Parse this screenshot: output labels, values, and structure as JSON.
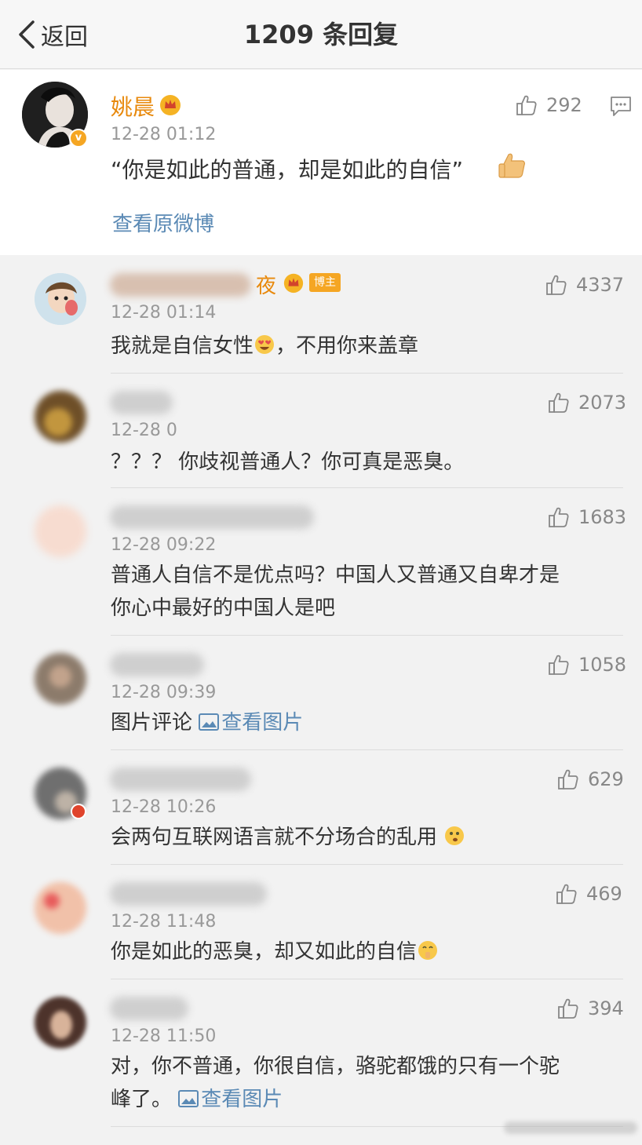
{
  "nav": {
    "back_label": "返回",
    "title": "1209 条回复"
  },
  "post": {
    "author": "姚晨",
    "time": "12-28 01:12",
    "text": "“你是如此的普通，却是如此的自信”",
    "like_count": "292",
    "view_original": "查看原微博",
    "emoji": "thumbs-up"
  },
  "replies": [
    {
      "name_visible": "夜",
      "badge": "博主",
      "time": "12-28 01:14",
      "text": "我就是自信女性",
      "text_after": "，不用你来盖章",
      "like_count": "4337"
    },
    {
      "time": "12-28 0",
      "text": "？？？ 你歧视普通人？你可真是恶臭。",
      "like_count": "2073"
    },
    {
      "time": "12-28 09:22",
      "line1": "普通人自信不是优点吗？中国人又普通又自卑才是",
      "line2": "你心中最好的中国人是吧",
      "like_count": "1683"
    },
    {
      "time": "12-28 09:39",
      "text": "图片评论",
      "pic_link": "查看图片",
      "like_count": "1058"
    },
    {
      "time": "12-28 10:26",
      "text": "会两句互联网语言就不分场合的乱用",
      "like_count": "629"
    },
    {
      "time": "12-28 11:48",
      "text": "你是如此的恶臭，却又如此的自信",
      "like_count": "469"
    },
    {
      "time": "12-28 11:50",
      "line1": "对，你不普通，你很自信，骆驼都饿的只有一个驼",
      "line2": "峰了。",
      "pic_link": "查看图片",
      "like_count": "394"
    }
  ],
  "colors": {
    "accent_name": "#e8890c",
    "link": "#5b8ab5",
    "muted": "#999999"
  }
}
